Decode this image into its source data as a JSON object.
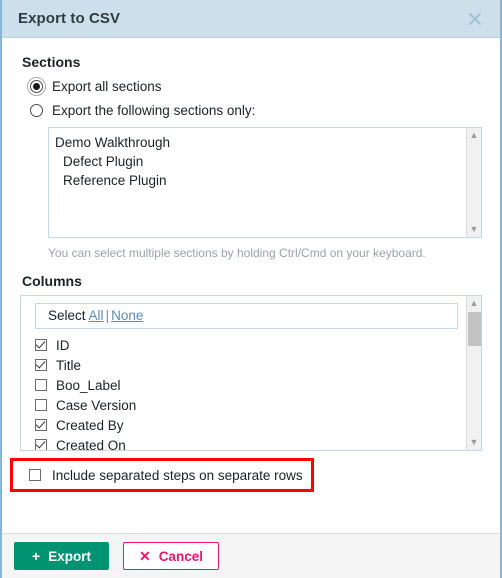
{
  "dialog": {
    "title": "Export to CSV",
    "close_icon": "close-icon"
  },
  "sections": {
    "label": "Sections",
    "options": [
      {
        "label": "Export all sections",
        "selected": true
      },
      {
        "label": "Export the following sections only:",
        "selected": false
      }
    ],
    "list_items": [
      {
        "label": "Demo Walkthrough",
        "indent": false
      },
      {
        "label": "Defect Plugin",
        "indent": true
      },
      {
        "label": "Reference Plugin",
        "indent": true
      }
    ],
    "hint": "You can select multiple sections by holding Ctrl/Cmd on your keyboard.",
    "scroll_up_icon": "chevron-up-icon",
    "scroll_down_icon": "chevron-down-icon"
  },
  "columns": {
    "label": "Columns",
    "select_prefix": "Select",
    "select_all": "All",
    "separator": "|",
    "select_none": "None",
    "items": [
      {
        "label": "ID",
        "checked": true
      },
      {
        "label": "Title",
        "checked": true
      },
      {
        "label": "Boo_Label",
        "checked": false
      },
      {
        "label": "Case Version",
        "checked": false
      },
      {
        "label": "Created By",
        "checked": true
      },
      {
        "label": "Created On",
        "checked": true
      }
    ],
    "scroll_up_icon": "chevron-up-icon",
    "scroll_down_icon": "chevron-down-icon"
  },
  "separate_rows": {
    "label": "Include separated steps on separate rows",
    "checked": false,
    "highlight_color": "#ff0000"
  },
  "footer": {
    "export_label": "Export",
    "export_icon": "plus-icon",
    "export_color": "#009371",
    "cancel_label": "Cancel",
    "cancel_icon": "x-icon",
    "cancel_color": "#e6186c"
  }
}
